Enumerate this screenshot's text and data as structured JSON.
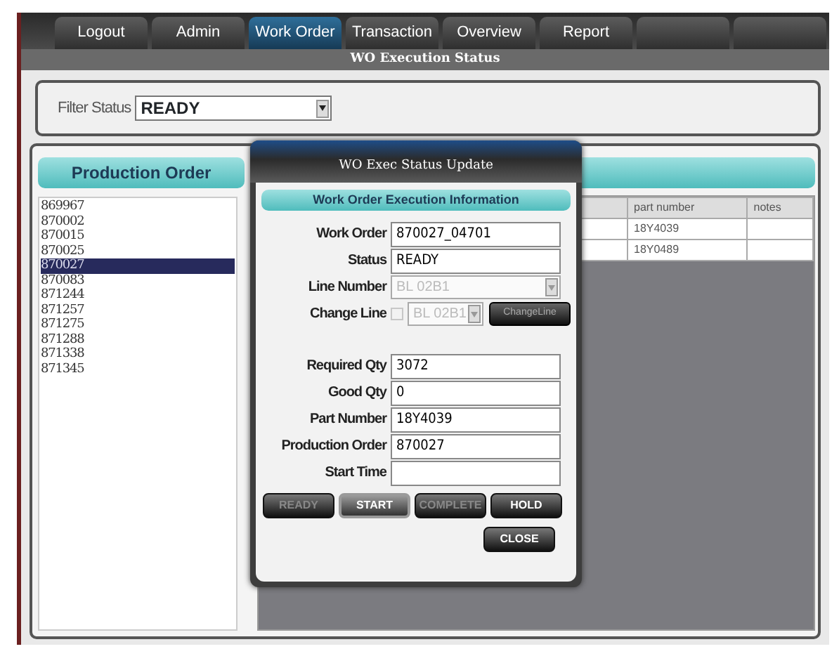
{
  "tabs": [
    {
      "label": "Logout",
      "selected": false
    },
    {
      "label": "Admin",
      "selected": false
    },
    {
      "label": "Work Order",
      "selected": true
    },
    {
      "label": "Transaction",
      "selected": false
    },
    {
      "label": "Overview",
      "selected": false
    },
    {
      "label": "Report",
      "selected": false
    },
    {
      "selected": false
    },
    {
      "selected": false
    }
  ],
  "screen_title": "WO Execution Status",
  "filter": {
    "label": "Filter Status",
    "value": "READY"
  },
  "production_order": {
    "title": "Production Order",
    "items": [
      {
        "label": "869967",
        "selected": false
      },
      {
        "label": "870002",
        "selected": false
      },
      {
        "label": "870015",
        "selected": false
      },
      {
        "label": "870025",
        "selected": false
      },
      {
        "label": "870027",
        "selected": true
      },
      {
        "label": "870083",
        "selected": false
      },
      {
        "label": "871244",
        "selected": false
      },
      {
        "label": "871257",
        "selected": false
      },
      {
        "label": "871275",
        "selected": false
      },
      {
        "label": "871288",
        "selected": false
      },
      {
        "label": "871338",
        "selected": false
      },
      {
        "label": "871345",
        "selected": false
      }
    ]
  },
  "table": {
    "columns": [
      "part number",
      "notes"
    ],
    "rows": [
      {
        "cells": [
          "18Y4039",
          ""
        ]
      },
      {
        "cells": [
          "18Y0489",
          ""
        ]
      }
    ]
  },
  "dialog": {
    "title": "WO Exec Status Update",
    "section": "Work Order Execution Information",
    "fields": [
      {
        "kind": "text",
        "label": "Work Order",
        "value": "870027_04701"
      },
      {
        "kind": "text",
        "label": "Status",
        "value": "READY"
      },
      {
        "kind": "select",
        "label": "Line Number",
        "value": "BL 02B1",
        "disabled": true
      },
      {
        "kind": "changeline",
        "label": "Change Line",
        "value": "BL 02B1",
        "checked": false,
        "disabled": true,
        "button": "ChangeLine"
      },
      {
        "kind": "gap"
      },
      {
        "kind": "text",
        "label": "Required Qty",
        "value": "3072"
      },
      {
        "kind": "text",
        "label": "Good Qty",
        "value": "0"
      },
      {
        "kind": "text",
        "label": "Part Number",
        "value": "18Y4039"
      },
      {
        "kind": "text",
        "label": "Production Order",
        "value": "870027"
      },
      {
        "kind": "text",
        "label": "Start Time"
      }
    ],
    "buttons": [
      {
        "label": "READY",
        "disabled": true,
        "selected": false
      },
      {
        "label": "START",
        "disabled": false,
        "selected": true
      },
      {
        "label": "COMPLETE",
        "disabled": true,
        "selected": false
      },
      {
        "label": "HOLD",
        "disabled": false,
        "selected": false
      }
    ],
    "close": "CLOSE"
  }
}
